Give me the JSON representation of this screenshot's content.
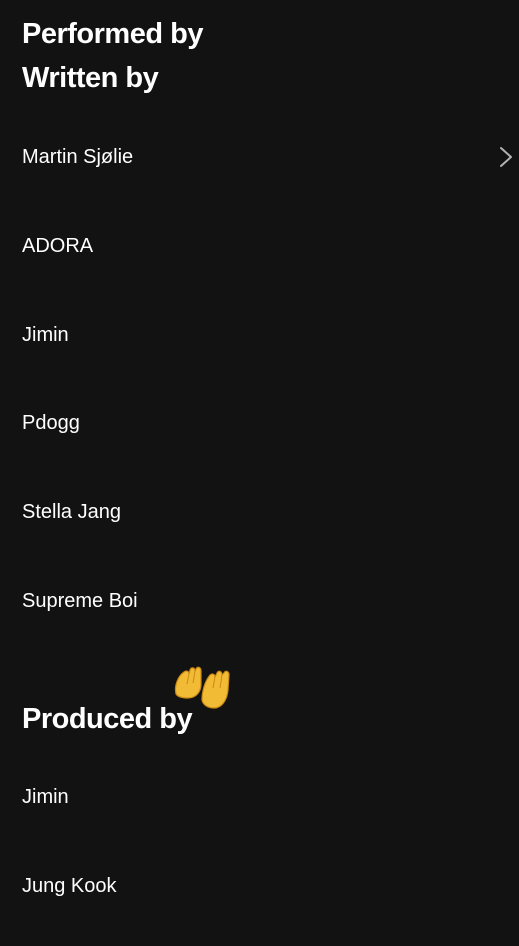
{
  "sections": {
    "performed_by": {
      "title": "Performed by"
    },
    "written_by": {
      "title": "Written by",
      "items": [
        "Martin Sjølie",
        "ADORA",
        "Jimin",
        "Pdogg",
        "Stella Jang",
        "Supreme Boi"
      ]
    },
    "produced_by": {
      "title": "Produced by",
      "items": [
        "Jimin",
        "Jung Kook"
      ]
    }
  },
  "icons": {
    "row_chevron": "chevron-right-icon",
    "decoration": "clapping-hands-emoji-icon"
  },
  "colors": {
    "background": "#121212",
    "text": "#ffffff",
    "chevron": "#b3b3b3",
    "emoji": "#f2bb36"
  }
}
